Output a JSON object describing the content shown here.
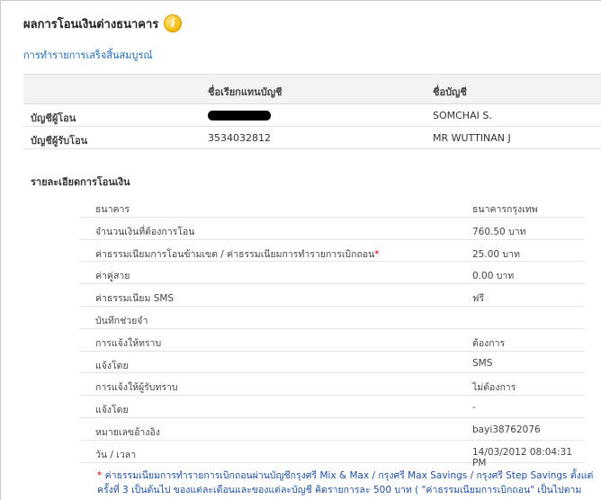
{
  "page": {
    "title": "ผลการโอนเงินต่างธนาคาร",
    "status": "การทำรายการเสร็จสิ้นสมบูรณ์"
  },
  "accounts": {
    "headers": [
      "",
      "ชื่อเรียกแทนบัญชี",
      "ชื่อบัญชี"
    ],
    "rows": [
      {
        "label": "บัญชีผู้โอน",
        "nickname": "",
        "name": "SOMCHAI S."
      },
      {
        "label": "บัญชีผู้รับโอน",
        "nickname": "3534032812",
        "name": "MR WUTTINAN J"
      }
    ]
  },
  "details": {
    "title": "รายละเอียดการโอนเงิน",
    "rows": [
      {
        "label": "ธนาคาร",
        "value": "ธนาคารกรุงเทพ"
      },
      {
        "label": "จำนวนเงินที่ต้องการโอน",
        "value": "760.50 บาท"
      },
      {
        "label": "ค่าธรรมเนียมการโอนข้ามเขต / ค่าธรรมเนียมการทำรายการเบิกถอน",
        "star": "*",
        "value": "25.00 บาท"
      },
      {
        "label": "ค่าคู่สาย",
        "value": "0.00 บาท"
      },
      {
        "label": "ค่าธรรมเนียม SMS",
        "value": "ฟรี"
      },
      {
        "label": "บันทึกช่วยจำ",
        "value": ""
      },
      {
        "label": "การแจ้งให้ทราบ",
        "value": "ต้องการ"
      },
      {
        "label": "แจ้งโดย",
        "value": "SMS"
      },
      {
        "label": "การแจ้งให้ผู้รับทราบ",
        "value": "ไม่ต้องการ"
      },
      {
        "label": "แจ้งโดย",
        "value": "-"
      },
      {
        "label": "หมายเลขอ้างอิง",
        "value": "bayi38762076"
      },
      {
        "label": "วัน / เวลา",
        "value": "14/03/2012 08:04:31 PM"
      }
    ]
  },
  "footnote": {
    "star": "*",
    "text": "ค่าธรรมเนียมการทำรายการเบิกถอนผ่านบัญชีกรุงศรี Mix & Max / กรุงศรี Max Savings / กรุงศรี Step Savings ตั้งแต่ครั้งที่ 3 เป็นต้นไป ของแต่ละเดือนและของแต่ละบัญชี คิดรายการละ 500 บาท ( \"ค่าธรรมเนียมการเบิกถอน\" เป็นไปตาม"
  }
}
